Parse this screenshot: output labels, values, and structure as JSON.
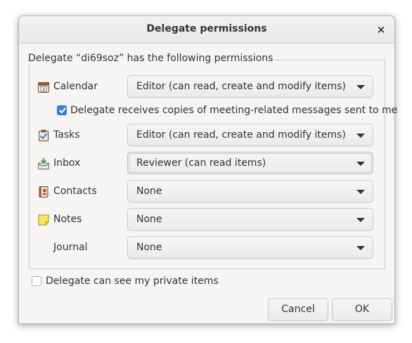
{
  "dialog": {
    "title": "Delegate permissions",
    "close_label": "×"
  },
  "frame_label": "Delegate “di69soz” has the following permissions",
  "rows": [
    {
      "label": "Calendar",
      "value": "Editor (can read, create and modify items)",
      "icon": "calendar-icon"
    },
    {
      "label": "Tasks",
      "value": "Editor (can read, create and modify items)",
      "icon": "tasks-icon"
    },
    {
      "label": "Inbox",
      "value": "Reviewer (can read items)",
      "icon": "inbox-icon"
    },
    {
      "label": "Contacts",
      "value": "None",
      "icon": "contacts-icon"
    },
    {
      "label": "Notes",
      "value": "None",
      "icon": "notes-icon"
    },
    {
      "label": "Journal",
      "value": "None",
      "icon": ""
    }
  ],
  "meeting_copies": {
    "label": "Delegate receives copies of meeting-related messages sent to me",
    "checked": true
  },
  "private_items": {
    "label": "Delegate can see my private items",
    "checked": false
  },
  "buttons": {
    "cancel": "Cancel",
    "ok": "OK"
  },
  "colors": {
    "accent": "#3584e4",
    "dialog_bg": "#f6f5f4",
    "text": "#2e3436"
  }
}
